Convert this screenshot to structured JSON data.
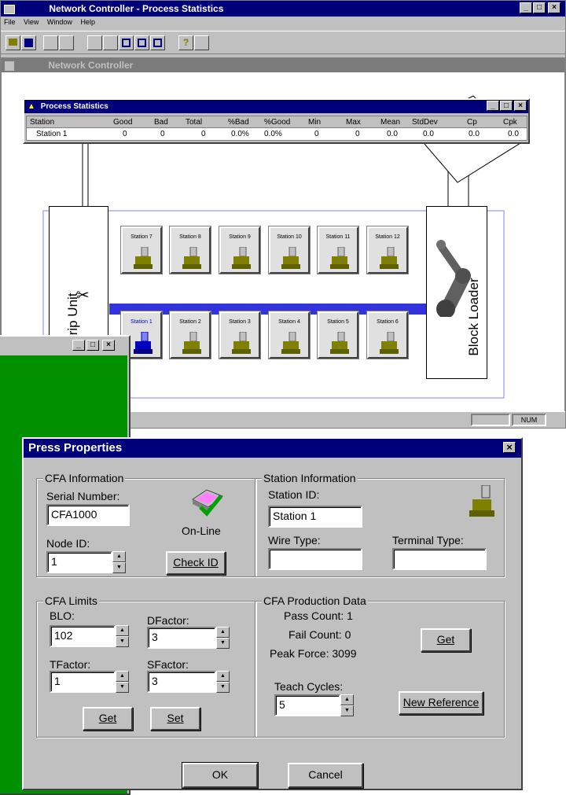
{
  "main_window": {
    "title": "Network Controller - Process Statistics",
    "menu": [
      "File",
      "View",
      "Window",
      "Help"
    ],
    "child_title": "Network Controller",
    "status_num": "NUM"
  },
  "process_stats": {
    "title": "Process Statistics",
    "columns": [
      "Station",
      "Good",
      "Bad",
      "Total",
      "%Bad",
      "%Good",
      "Min",
      "Max",
      "Mean",
      "StdDev",
      "Cp",
      "Cpk"
    ],
    "row": [
      "Station 1",
      "0",
      "0",
      "0",
      "0.0%",
      "0.0%",
      "0",
      "0",
      "0.0",
      "0.0",
      "0.0",
      "0.0"
    ]
  },
  "diagram": {
    "cut_strip_unit": "Cut Strip Unit",
    "block_loader": "Block Loader",
    "top_stations": [
      "Station 7",
      "Station 8",
      "Station 9",
      "Station 10",
      "Station 11",
      "Station 12"
    ],
    "bottom_stations": [
      "Station 1",
      "Station 2",
      "Station 3",
      "Station 4",
      "Station 5",
      "Station 6"
    ]
  },
  "press_dialog": {
    "title": "Press Properties",
    "cfa_info": {
      "legend": "CFA Information",
      "serial_label": "Serial Number:",
      "serial_value": "CFA1000",
      "status": "On-Line",
      "node_label": "Node ID:",
      "node_value": "1",
      "check_id": "Check ID"
    },
    "station_info": {
      "legend": "Station Information",
      "station_id_label": "Station ID:",
      "station_id_value": "Station 1",
      "wire_type_label": "Wire Type:",
      "wire_type_value": "",
      "terminal_type_label": "Terminal Type:",
      "terminal_type_value": ""
    },
    "cfa_limits": {
      "legend": "CFA Limits",
      "blo_label": "BLO:",
      "blo_value": "102",
      "dfactor_label": "DFactor:",
      "dfactor_value": "3",
      "tfactor_label": "TFactor:",
      "tfactor_value": "1",
      "sfactor_label": "SFactor:",
      "sfactor_value": "3",
      "get": "Get",
      "set": "Set"
    },
    "production": {
      "legend": "CFA Production Data",
      "pass_count": "Pass Count: 1",
      "fail_count": "Fail Count:  0",
      "peak_force": "Peak Force:  3099",
      "get": "Get",
      "teach_label": "Teach Cycles:",
      "teach_value": "5",
      "new_reference": "New Reference"
    },
    "ok": "OK",
    "cancel": "Cancel"
  },
  "colors": {
    "title_active": "#00007b",
    "face": "#c0c0c0",
    "green_window": "#009000",
    "conveyor": "#3333dd",
    "press_olive": "#808000"
  }
}
